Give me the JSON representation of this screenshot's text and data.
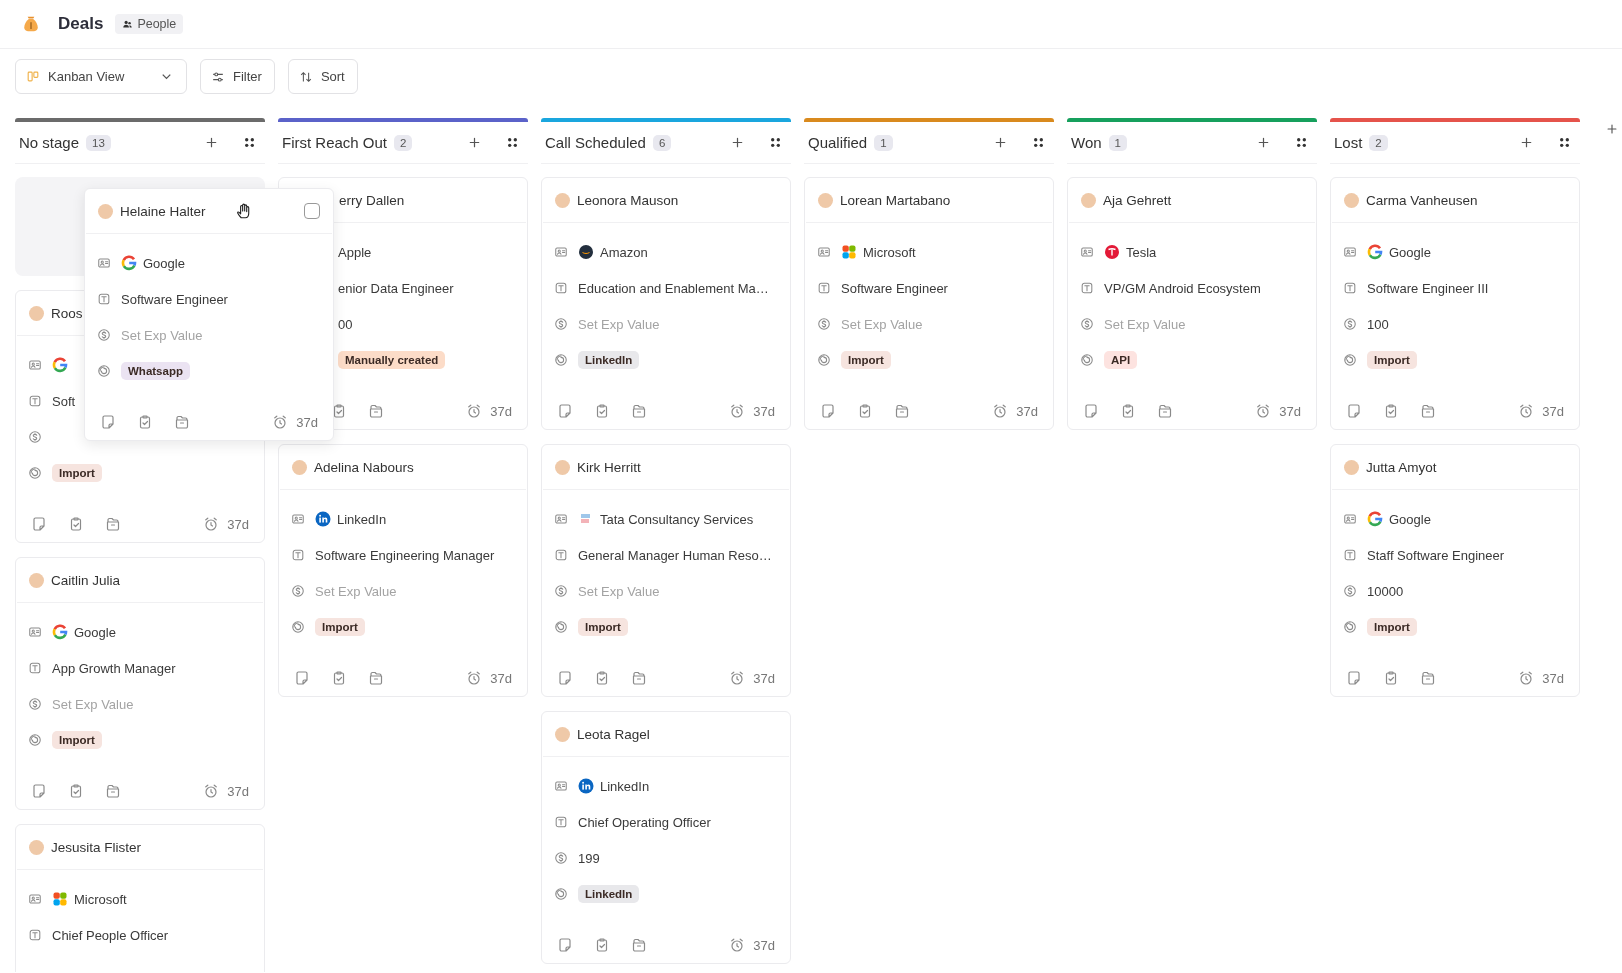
{
  "header": {
    "title": "Deals",
    "chip": "People"
  },
  "toolbar": {
    "view": "Kanban View",
    "filter": "Filter",
    "sort": "Sort"
  },
  "columns": [
    {
      "title": "No stage",
      "count": "13",
      "color": "#6b6b6b",
      "cards": [
        {
          "kind": "placeholder"
        },
        {
          "kind": "deal",
          "name": "Roos",
          "company": {
            "kind": "google"
          },
          "title": "Soft",
          "tag": {
            "label": "Import",
            "color": "#f6e4df"
          },
          "age": "37d"
        },
        {
          "kind": "deal",
          "name": "Caitlin Julia",
          "company": {
            "kind": "google",
            "name": "Google"
          },
          "title": "App Growth Manager",
          "placeholder": "Set Exp Value",
          "tag": {
            "label": "Import",
            "color": "#f6e4df"
          },
          "age": "37d"
        },
        {
          "kind": "deal",
          "name": "Jesusita Flister",
          "company": {
            "kind": "microsoft",
            "name": "Microsoft"
          },
          "title": "Chief People Officer"
        }
      ]
    },
    {
      "title": "First Reach Out",
      "count": "2",
      "color": "#5b62c9",
      "cards": [
        {
          "kind": "deal",
          "covered_left": true,
          "name": "erry Dallen",
          "company": {
            "name": "Apple"
          },
          "title": "enior Data Engineer",
          "value": "00",
          "tag": {
            "label": "Manually created",
            "color": "#fcdcc8"
          },
          "age": "37d"
        },
        {
          "kind": "deal",
          "name": "Adelina Nabours",
          "company": {
            "kind": "linkedin",
            "name": "LinkedIn"
          },
          "title": "Software Engineering Manager",
          "placeholder": "Set Exp Value",
          "tag": {
            "label": "Import",
            "color": "#f6e4df"
          },
          "age": "37d"
        }
      ]
    },
    {
      "title": "Call Scheduled",
      "count": "6",
      "color": "#1aa6de",
      "cards": [
        {
          "kind": "deal",
          "name": "Leonora Mauson",
          "company": {
            "kind": "amazon",
            "name": "Amazon"
          },
          "title": "Education and Enablement Ma…",
          "placeholder": "Set Exp Value",
          "tag": {
            "label": "LinkedIn",
            "color": "#e8e8eb"
          },
          "age": "37d"
        },
        {
          "kind": "deal",
          "name": "Kirk Herritt",
          "company": {
            "kind": "tata",
            "name": "Tata Consultancy Services"
          },
          "title": "General Manager Human Reso…",
          "placeholder": "Set Exp Value",
          "tag": {
            "label": "Import",
            "color": "#f6e4df"
          },
          "age": "37d"
        },
        {
          "kind": "deal",
          "name": "Leota Ragel",
          "company": {
            "kind": "linkedin",
            "name": "LinkedIn"
          },
          "title": "Chief Operating Officer",
          "value": "199",
          "tag": {
            "label": "LinkedIn",
            "color": "#e8e8eb"
          },
          "age": "37d"
        }
      ]
    },
    {
      "title": "Qualified",
      "count": "1",
      "color": "#d98a1e",
      "cards": [
        {
          "kind": "deal",
          "name": "Lorean Martabano",
          "company": {
            "kind": "microsoft",
            "name": "Microsoft"
          },
          "title": "Software Engineer",
          "placeholder": "Set Exp Value",
          "tag": {
            "label": "Import",
            "color": "#f6e4df"
          },
          "age": "37d"
        }
      ]
    },
    {
      "title": "Won",
      "count": "1",
      "color": "#17a05d",
      "cards": [
        {
          "kind": "deal",
          "name": "Aja Gehrett",
          "company": {
            "kind": "tesla",
            "name": "Tesla"
          },
          "title": "VP/GM Android Ecosystem",
          "placeholder": "Set Exp Value",
          "tag": {
            "label": "API",
            "color": "#fde3e0"
          },
          "age": "37d"
        }
      ]
    },
    {
      "title": "Lost",
      "count": "2",
      "color": "#e5534b",
      "cards": [
        {
          "kind": "deal",
          "name": "Carma Vanheusen",
          "company": {
            "kind": "google",
            "name": "Google"
          },
          "title": "Software Engineer III",
          "value": "100",
          "tag": {
            "label": "Import",
            "color": "#f6e4df"
          },
          "age": "37d"
        },
        {
          "kind": "deal",
          "name": "Jutta Amyot",
          "company": {
            "kind": "google",
            "name": "Google"
          },
          "title": "Staff Software Engineer",
          "value": "10000",
          "tag": {
            "label": "Import",
            "color": "#f6e4df"
          },
          "age": "37d"
        }
      ]
    }
  ],
  "dragged_card": {
    "kind": "deal",
    "name": "Helaine Halter",
    "checked": false,
    "company": {
      "kind": "google",
      "name": "Google"
    },
    "title": "Software Engineer",
    "placeholder": "Set Exp Value",
    "tag": {
      "label": "Whatsapp",
      "color": "#ebe3f2"
    },
    "age": "37d"
  }
}
